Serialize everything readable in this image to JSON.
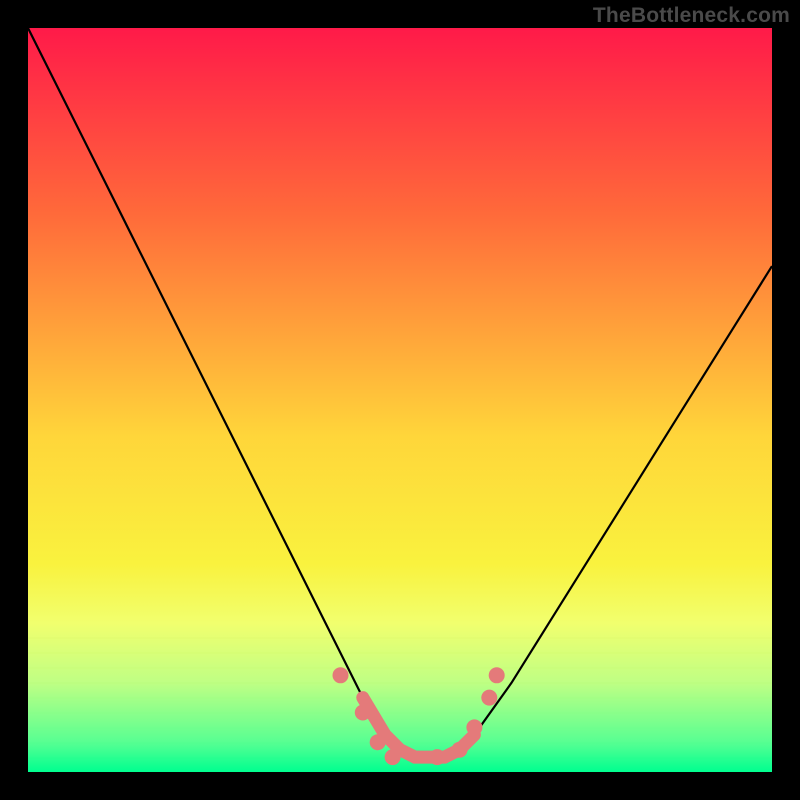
{
  "watermark": "TheBottleneck.com",
  "chart_data": {
    "type": "line",
    "title": "",
    "xlabel": "",
    "ylabel": "",
    "xlim": [
      0,
      100
    ],
    "ylim": [
      0,
      100
    ],
    "grid": false,
    "legend": false,
    "background": {
      "type": "vertical-gradient",
      "stops": [
        {
          "pos": 0,
          "color": "#ff1a49"
        },
        {
          "pos": 25,
          "color": "#ff6a3a"
        },
        {
          "pos": 55,
          "color": "#ffd63a"
        },
        {
          "pos": 72,
          "color": "#f9f23e"
        },
        {
          "pos": 80,
          "color": "#f1ff6e"
        },
        {
          "pos": 88,
          "color": "#bfff84"
        },
        {
          "pos": 96,
          "color": "#58ff92"
        },
        {
          "pos": 100,
          "color": "#00ff90"
        }
      ]
    },
    "series": [
      {
        "name": "bottleneck-curve",
        "color": "#000000",
        "x": [
          0,
          5,
          10,
          15,
          20,
          25,
          30,
          35,
          40,
          45,
          48,
          50,
          52,
          54,
          56,
          58,
          60,
          65,
          70,
          75,
          80,
          85,
          90,
          95,
          100
        ],
        "y": [
          100,
          90,
          80,
          70,
          60,
          50,
          40,
          30,
          20,
          10,
          5,
          3,
          2,
          2,
          2,
          3,
          5,
          12,
          20,
          28,
          36,
          44,
          52,
          60,
          68
        ]
      }
    ],
    "markers": {
      "name": "segment-dots",
      "color": "#e47a7a",
      "points": [
        {
          "x": 42,
          "y": 13
        },
        {
          "x": 45,
          "y": 8
        },
        {
          "x": 47,
          "y": 4
        },
        {
          "x": 49,
          "y": 2
        },
        {
          "x": 55,
          "y": 2
        },
        {
          "x": 58,
          "y": 3
        },
        {
          "x": 60,
          "y": 6
        },
        {
          "x": 62,
          "y": 10
        },
        {
          "x": 63,
          "y": 13
        }
      ]
    },
    "highlight_band": {
      "name": "optimal-range-stroke",
      "color": "#e47a7a",
      "x_from": 47,
      "x_to": 58,
      "y": 2
    }
  }
}
